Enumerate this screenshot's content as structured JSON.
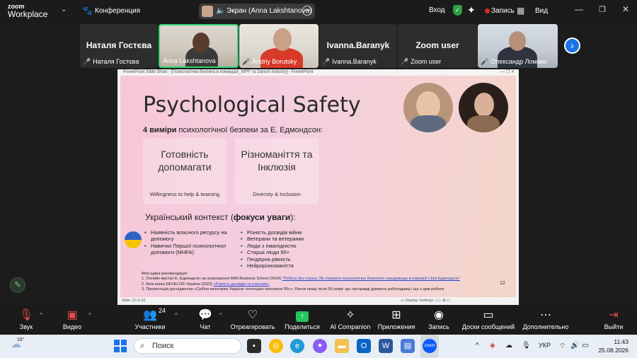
{
  "app": {
    "logo_line1": "zoom",
    "logo_line2": "Workplace",
    "conference_label": "Конференция"
  },
  "topbar": {
    "screen_share_label": "Экран (Anna Lakshtanova)",
    "login_label": "Вход",
    "record_label": "Запись",
    "view_label": "Вид"
  },
  "participants": [
    {
      "big_name": "Наталя Гостєва",
      "label": "Наталя Гостєва",
      "muted": true,
      "video": false
    },
    {
      "big_name": "",
      "label": "Anna Lakshtanova",
      "muted": false,
      "video": true,
      "active_speaker": true
    },
    {
      "big_name": "",
      "label": "Andriy Borutsky",
      "muted": true,
      "video": true
    },
    {
      "big_name": "Ivanna.Baranyk",
      "label": "Ivanna.Baranyk",
      "muted": true,
      "video": false
    },
    {
      "big_name": "Zoom user",
      "label": "Zoom user",
      "muted": true,
      "video": false
    },
    {
      "big_name": "",
      "label": "Олександр Ломако",
      "muted": true,
      "video": true
    }
  ],
  "ppt": {
    "window_title": "PowerPoint Slide Show - [Психологічна безпека в командах_WPF та Danish Industry] - PowerPoint",
    "status_left": "Slide 12 of 32",
    "status_right": "Display Settings"
  },
  "slide": {
    "title": "Psychological Safety",
    "subtitle_bold": "4 виміри",
    "subtitle_rest": " психологічної безпеки за Е. Едмондсон:",
    "cards": [
      {
        "heading": "Готовність допомагати",
        "sub": "Willingness to help & teaming"
      },
      {
        "heading": "Різноманіття та Інклюзія",
        "sub": "Diversity & Inclusion"
      }
    ],
    "context_title_a": "Український контекст (",
    "context_title_b": "фокуси уваги",
    "context_title_c": "):",
    "list_left": [
      "Наявність власного ресурсу на допомогу",
      "Навички Першої психологічної допомоги (MHFA)"
    ],
    "list_right": [
      "Різність досвідів війни",
      "Ветерани та ветеранки",
      "Люди з інвалідністю",
      "Старші люди 50+",
      "Гендерна рівність",
      "Нейрорізноманіття"
    ],
    "refs_title": "Моя щира рекомендація:",
    "ref1_a": "1.   Онлайн-виступ Е. Едмондсон на запрошення MIM Business School (2024) ",
    "ref1_link": "\"Робота без страху. Як створити психологічно безпечне середовище в компанії | Емі Едмондсон\"",
    "ref2_a": "2.   Біла книга DEVELOR Україна (2023) ",
    "ref2_link": "«Різність досвідів та Інклюзія»",
    "ref3": "3.   Презентація дослідження «Срібна економіка України: потенціал покоління 55+»: Ринок праці після 50 років: що насправді думають роботодавці і що з цим робити",
    "slide_number": "12"
  },
  "toolbar": {
    "items": [
      {
        "label": "Звук",
        "icon": "mic-muted-icon"
      },
      {
        "label": "Видео",
        "icon": "video-off-icon"
      },
      {
        "label": "Участники",
        "icon": "participants-icon",
        "count": "24"
      },
      {
        "label": "Чат",
        "icon": "chat-icon"
      },
      {
        "label": "Отреагировать",
        "icon": "heart-icon"
      },
      {
        "label": "Поделиться",
        "icon": "share-screen-icon"
      },
      {
        "label": "AI Companion",
        "icon": "ai-sparkle-icon"
      },
      {
        "label": "Приложения",
        "icon": "apps-icon"
      },
      {
        "label": "Запись",
        "icon": "record-icon"
      },
      {
        "label": "Доски сообщений",
        "icon": "whiteboard-icon"
      },
      {
        "label": "Дополнительно",
        "icon": "more-icon"
      },
      {
        "label": "Выйти",
        "icon": "leave-icon"
      }
    ]
  },
  "taskbar": {
    "temperature": "16°",
    "search_placeholder": "Поиск",
    "language": "УКР",
    "time": "11:43",
    "date": "25.08.2026"
  },
  "colors": {
    "accent_green": "#2ed573",
    "record_red": "#e02828",
    "zoom_blue": "#1a73e8",
    "slide_pink": "#f6c7d9"
  }
}
